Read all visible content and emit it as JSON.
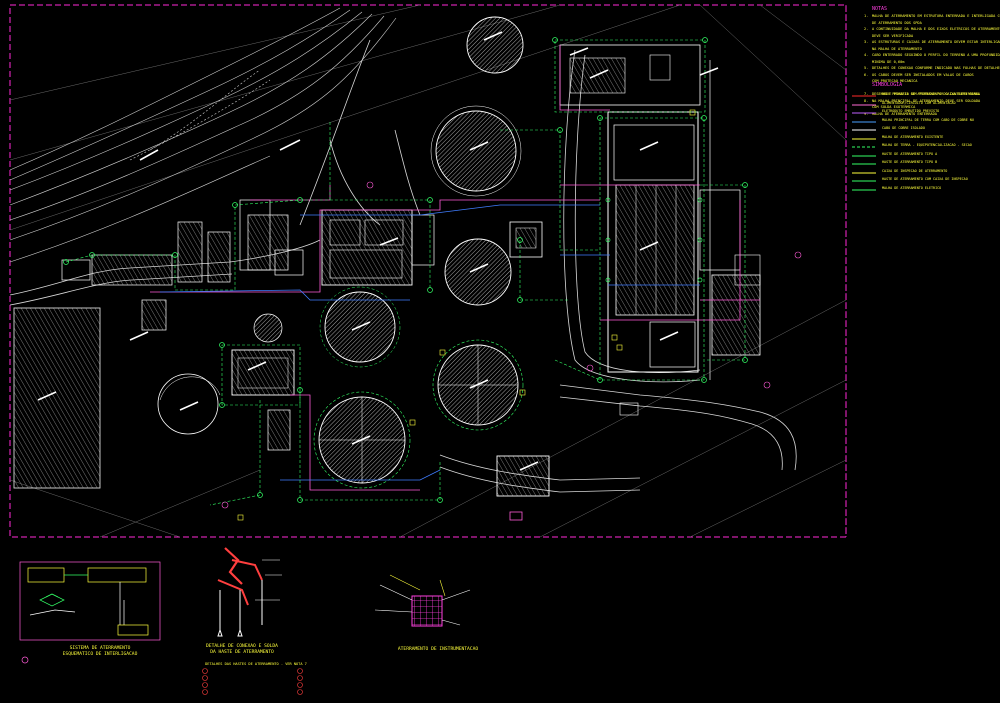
{
  "notes": {
    "header": "NOTAS",
    "items": [
      {
        "n": "1.",
        "text": "MALHA DE ATERRAMENTO EM ESTRUTURA ENTERRADA E INTERLIGADA COM DESCIDAS"
      },
      {
        "n": "",
        "text": "DE ATERRAMENTO DOS SPDA"
      },
      {
        "n": "2.",
        "text": "A CONTINUIDADE DA MALHA E DOS EIXOS ELETRICOS DE ATERRAMENTO"
      },
      {
        "n": "",
        "text": "DEVE SER VERIFICADA"
      },
      {
        "n": "3.",
        "text": "AS ESTRUTURAS E CAIXAS DE ATERRAMENTO DEVEM ESTAR INTERLIGADAS"
      },
      {
        "n": "",
        "text": "NA MALHA DE ATERRAMENTO"
      },
      {
        "n": "4.",
        "text": "CABO ENTERRADO SEGUINDO O PERFIL DO TERRENO A UMA PROFUNDIDADE"
      },
      {
        "n": "",
        "text": "MINIMA DE 0,60m"
      },
      {
        "n": "5.",
        "text": "DETALHES DE CONEXAO CONFORME INDICADO NAS FOLHAS DE DETALHES"
      },
      {
        "n": "6.",
        "text": "OS CABOS DEVEM SER INSTALADOS EM VALAS DE CABOS"
      },
      {
        "n": "",
        "text": "COM PROTECAO MECANICA"
      },
      {
        "n": "",
        "text": ""
      },
      {
        "n": "7.",
        "text": "DESENHO E PROJETO DE ATERRAMENTO DO CANTEIRO GERAL"
      },
      {
        "n": "8.",
        "text": "NA MALHA PRINCIPAL DE ATERRAMENTO DEVE SER SOLDADA"
      },
      {
        "n": "",
        "text": "COM SOLDA EXOTERMICA"
      },
      {
        "n": "9.",
        "text": "MALHA DE ATERRAMENTO ENTERRADA"
      }
    ]
  },
  "legend": {
    "header": "SIMBOLOGIA",
    "items": [
      {
        "color": "#ff2a2a",
        "dash": "",
        "text": "REDE PRIMARIA SEM PROTECAO POR CAIXA SUBTERRANEA"
      },
      {
        "color": "#ff6ad5",
        "dash": "",
        "text": "ALIMENTADOR/CIRCUITO COM ALIMENTACAO"
      },
      {
        "color": "#c060ff",
        "dash": "",
        "text": "ELETRODUTO EMBUTIDO PREVISTO"
      },
      {
        "color": "#4aa0ff",
        "dash": "",
        "text": "MALHA PRINCIPAL DE TERRA COM CABO DE COBRE NU"
      },
      {
        "color": "#ffffff",
        "dash": "",
        "text": "CABO DE COBRE ISOLADO"
      },
      {
        "color": "#ffff3c",
        "dash": "",
        "text": "MALHA DE ATERRAMENTO EXISTENTE"
      },
      {
        "color": "#33ff66",
        "dash": "3 2",
        "text": "MALHA DE TERRA - EQUIPOTENCIALIZACAO - SECAO"
      },
      {
        "color": "#33ff66",
        "dash": "",
        "text": "HASTE DE ATERRAMENTO TIPO A"
      },
      {
        "color": "#33ff66",
        "dash": "",
        "text": "HASTE DE ATERRAMENTO TIPO B"
      },
      {
        "color": "#ffff3c",
        "dash": "",
        "text": "CAIXA DE INSPECAO DE ATERRAMENTO"
      },
      {
        "color": "#33ff66",
        "dash": "",
        "text": "HASTE DE ATERRAMENTO COM CAIXA DE INSPECAO"
      },
      {
        "color": "#33ff66",
        "dash": "",
        "text": "MALHA DE ATERRAMENTO ELETRICO"
      }
    ]
  },
  "detail_titles": {
    "detail1": "SISTEMA DE ATERRAMENTO",
    "detail1b": "ESQUEMATICO DE INTERLIGACAO",
    "detail2": "DETALHE DE CONEXAO E SOLDA",
    "detail2b": "DA HASTE DE ATERRAMENTO",
    "detail3": "ATERRAMENTO DE INSTRUMENTACAO",
    "bottom_note": "DETALHES DAS HASTES DE ATERRAMENTO - VER NOTA 7"
  },
  "colors": {
    "border": "#ff2ad6",
    "ground": "#33ff66",
    "building": "#ffffff",
    "road": "#d8d8d8",
    "accent": "#ffff3c"
  }
}
